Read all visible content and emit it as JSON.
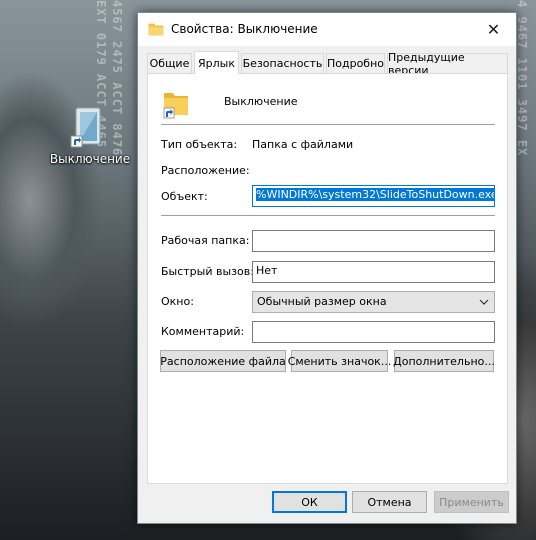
{
  "desktop": {
    "wallpaper_text_left": [
      "EXT 0179 ACCT 4465",
      "4567 2475 ACCT 8476"
    ],
    "wallpaper_text_right": "4 9467 1101 3497 EX",
    "icon_label": "Выключение"
  },
  "dialog": {
    "title": "Свойства: Выключение",
    "tabs": [
      "Общие",
      "Ярлык",
      "Безопасность",
      "Подробно",
      "Предыдущие версии"
    ],
    "active_tab": "Ярлык",
    "shortcut_name": "Выключение",
    "fields": {
      "type_label": "Тип объекта:",
      "type_value": "Папка с файлами",
      "location_label": "Расположение:",
      "target_label": "Объект:",
      "target_value": "%WINDIR%\\system32\\SlideToShutDown.exe",
      "start_in_label": "Рабочая папка:",
      "start_in_value": "",
      "hotkey_label": "Быстрый вызов:",
      "hotkey_value": "Нет",
      "run_label": "Окно:",
      "run_value": "Обычный размер окна",
      "comment_label": "Комментарий:",
      "comment_value": ""
    },
    "buttons": {
      "open_location": "Расположение файла",
      "change_icon": "Сменить значок...",
      "advanced": "Дополнительно...",
      "ok": "ОК",
      "cancel": "Отмена",
      "apply": "Применить"
    }
  },
  "colors": {
    "selection": "#0078d7",
    "folder": "#f5c94a"
  }
}
